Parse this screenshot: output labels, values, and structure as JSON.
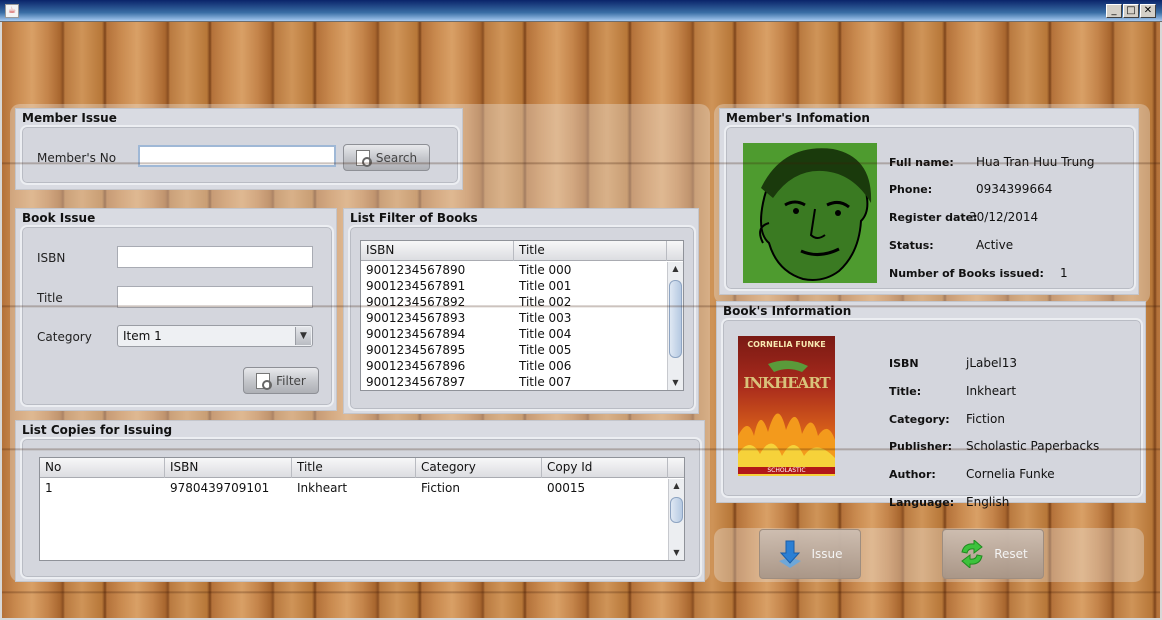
{
  "window": {
    "title": "",
    "app_icon": "java-icon",
    "controls": [
      "minimize",
      "maximize",
      "close"
    ]
  },
  "member_issue": {
    "title": "Member Issue",
    "member_no_label": "Member's No",
    "member_no_value": "",
    "search_label": "Search"
  },
  "book_issue": {
    "title": "Book Issue",
    "isbn_label": "ISBN",
    "isbn_value": "",
    "title_label": "Title",
    "title_value": "",
    "category_label": "Category",
    "category_selected": "Item 1",
    "filter_label": "Filter"
  },
  "list_filter": {
    "title": "List Filter of Books",
    "columns": [
      "ISBN",
      "Title"
    ],
    "rows": [
      [
        "9001234567890",
        "Title 000"
      ],
      [
        "9001234567891",
        "Title 001"
      ],
      [
        "9001234567892",
        "Title 002"
      ],
      [
        "9001234567893",
        "Title 003"
      ],
      [
        "9001234567894",
        "Title 004"
      ],
      [
        "9001234567895",
        "Title 005"
      ],
      [
        "9001234567896",
        "Title 006"
      ],
      [
        "9001234567897",
        "Title 007"
      ]
    ]
  },
  "list_copies": {
    "title": "List Copies for Issuing",
    "columns": [
      "No",
      "ISBN",
      "Title",
      "Category",
      "Copy Id"
    ],
    "rows": [
      [
        "1",
        "9780439709101",
        "Inkheart",
        "Fiction",
        "00015"
      ]
    ]
  },
  "member_info": {
    "title": "Member's Infomation",
    "fields": [
      {
        "label": "Full name:",
        "value": "Hua Tran Huu Trung"
      },
      {
        "label": "Phone:",
        "value": "0934399664"
      },
      {
        "label": "Register date:",
        "value": "30/12/2014"
      },
      {
        "label": "Status:",
        "value": "Active"
      },
      {
        "label": "Number of Books issued:",
        "value": "1"
      }
    ]
  },
  "book_info": {
    "title": "Book's Information",
    "cover_author": "CORNELIA FUNKE",
    "cover_title": "INKHEART",
    "cover_publisher": "SCHOLASTIC",
    "fields": [
      {
        "label": "ISBN",
        "value": "jLabel13"
      },
      {
        "label": "Title:",
        "value": "Inkheart"
      },
      {
        "label": "Category:",
        "value": "Fiction"
      },
      {
        "label": "Publisher:",
        "value": "Scholastic Paperbacks"
      },
      {
        "label": "Author:",
        "value": "Cornelia Funke"
      },
      {
        "label": "Language:",
        "value": "English"
      }
    ]
  },
  "actions": {
    "issue_label": "Issue",
    "reset_label": "Reset"
  }
}
